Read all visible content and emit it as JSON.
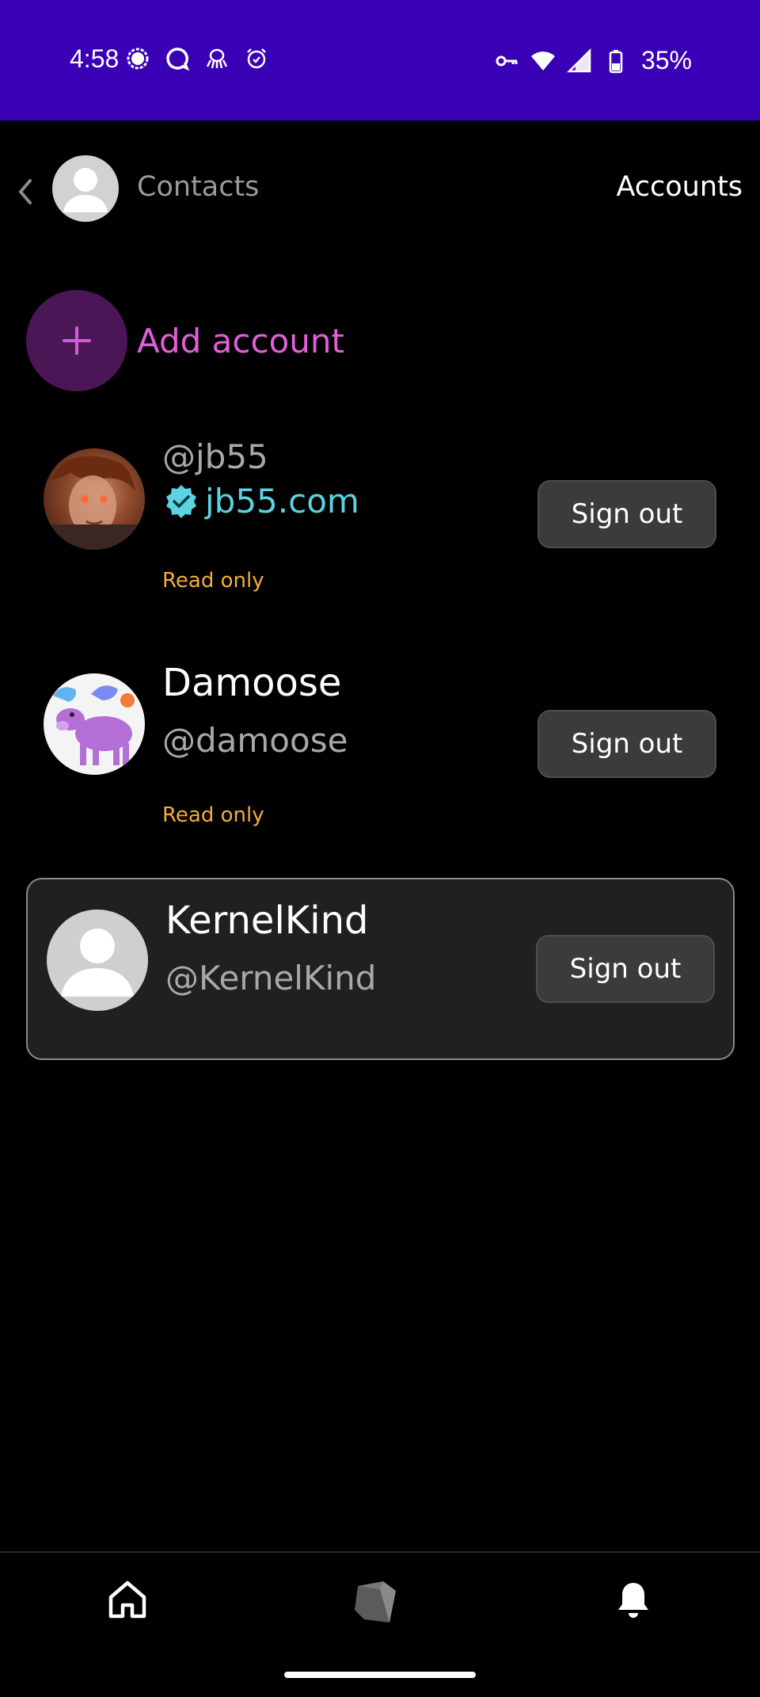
{
  "status_bar": {
    "time": "4:58",
    "battery": "35%",
    "left_icons": [
      "signal-app-icon",
      "chat-bubble-icon",
      "bug-icon",
      "alarm-icon"
    ],
    "right_icons": [
      "key-icon",
      "wifi-icon",
      "cell-signal-icon",
      "battery-icon"
    ],
    "background": "#3a00b6"
  },
  "header": {
    "back_icon": "chevron-left-icon",
    "contacts_label": "Contacts",
    "title": "Accounts"
  },
  "add_account": {
    "label": "Add account",
    "accent": "#e25fd9"
  },
  "accounts": [
    {
      "handle": "@jb55",
      "nip05": "jb55.com",
      "status": "Read only",
      "sign_out_label": "Sign out",
      "avatar": "photo-avatar"
    },
    {
      "name": "Damoose",
      "handle": "@damoose",
      "status": "Read only",
      "sign_out_label": "Sign out",
      "avatar": "moose-illustration-avatar"
    },
    {
      "name": "KernelKind",
      "handle": "@KernelKind",
      "sign_out_label": "Sign out",
      "avatar": "default-person-avatar",
      "selected": true
    }
  ],
  "colors": {
    "verified": "#5cd3df",
    "read_only": "#f4ac3c",
    "button_bg": "#3b3b3b"
  },
  "bottom_nav": {
    "items": [
      "home-icon",
      "cube-icon",
      "bell-icon"
    ]
  }
}
